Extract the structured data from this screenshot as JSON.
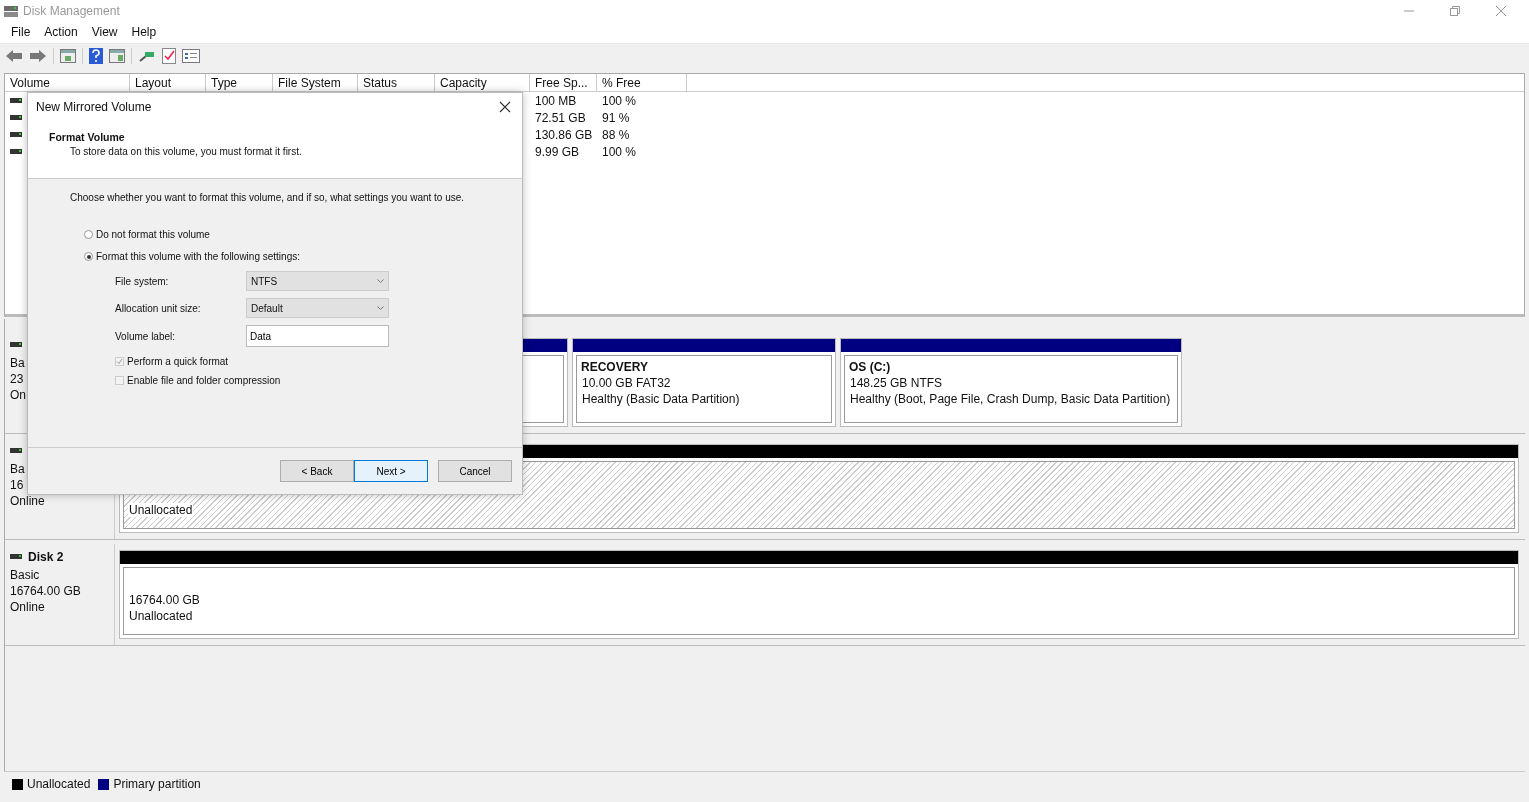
{
  "window": {
    "title": "Disk Management"
  },
  "menu": [
    "File",
    "Action",
    "View",
    "Help"
  ],
  "table": {
    "columns": [
      "Volume",
      "Layout",
      "Type",
      "File System",
      "Status",
      "Capacity",
      "Free Sp...",
      "% Free"
    ],
    "rows": [
      {
        "free": "100 MB",
        "percent": "100 %"
      },
      {
        "free": "72.51 GB",
        "percent": "91 %"
      },
      {
        "free": "130.86 GB",
        "percent": "88 %"
      },
      {
        "free": "9.99 GB",
        "percent": "100 %"
      }
    ]
  },
  "disks": [
    {
      "lines": [
        "Ba",
        "23",
        "On"
      ],
      "partitions": [
        {
          "kind": "primary",
          "selected": false
        },
        {
          "kind": "primary",
          "selected": false,
          "name": "RECOVERY",
          "lines": [
            "10.00 GB FAT32",
            "Healthy (Basic Data Partition)"
          ]
        },
        {
          "kind": "primary",
          "selected": false,
          "name": "OS  (C:)",
          "lines": [
            "148.25 GB NTFS",
            "Healthy (Boot, Page File, Crash Dump, Basic Data Partition)"
          ]
        }
      ]
    },
    {
      "lines": [
        "Ba",
        "16",
        "Online"
      ],
      "partitions": [
        {
          "kind": "unallocated",
          "selected": true,
          "lines": [
            "Unallocated"
          ]
        }
      ]
    },
    {
      "name": "Disk 2",
      "lines": [
        "Basic",
        "16764.00 GB",
        "Online"
      ],
      "partitions": [
        {
          "kind": "unallocated",
          "selected": false,
          "lines": [
            "16764.00 GB",
            "Unallocated"
          ]
        }
      ]
    }
  ],
  "legend": [
    {
      "label": "Unallocated",
      "color": "#000000"
    },
    {
      "label": "Primary partition",
      "color": "#000080"
    }
  ],
  "dialog": {
    "title": "New Mirrored Volume",
    "heading": "Format Volume",
    "subheading": "To store data on this volume, you must format it first.",
    "instruction": "Choose whether you want to format this volume, and if so, what settings you want to use.",
    "options": [
      {
        "label": "Do not format this volume",
        "selected": false
      },
      {
        "label": "Format this volume with the following settings:",
        "selected": true
      }
    ],
    "fields": [
      {
        "kind": "dropdown",
        "label": "File system:",
        "value": "NTFS"
      },
      {
        "kind": "dropdown",
        "label": "Allocation unit size:",
        "value": "Default"
      },
      {
        "kind": "text",
        "label": "Volume label:",
        "value": "Data"
      }
    ],
    "checkboxes": [
      {
        "label": "Perform a quick format",
        "checked": true,
        "disabled": true
      },
      {
        "label": "Enable file and folder compression",
        "checked": false,
        "disabled": true
      }
    ],
    "buttons": [
      {
        "label": "< Back",
        "default": false
      },
      {
        "label": "Next >",
        "default": true
      },
      {
        "label": "Cancel",
        "default": false
      }
    ]
  }
}
